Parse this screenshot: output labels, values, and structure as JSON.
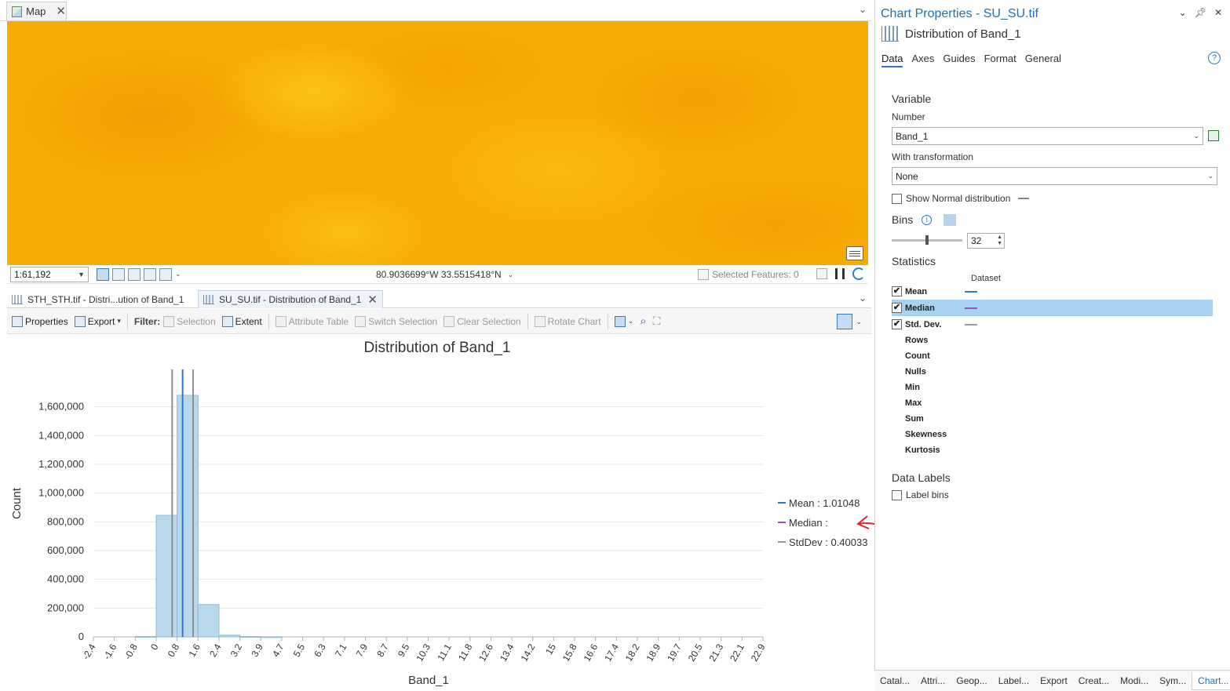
{
  "map": {
    "tab_label": "Map",
    "scale": "1:61,192",
    "coordinates": "80.9036699°W 33.5515418°N",
    "selected_features": "Selected Features: 0"
  },
  "chart_tabs": [
    {
      "label": "STH_STH.tif - Distri...ution of Band_1"
    },
    {
      "label": "SU_SU.tif - Distribution of Band_1"
    }
  ],
  "toolbar": {
    "properties": "Properties",
    "export": "Export",
    "filter": "Filter:",
    "selection": "Selection",
    "extent": "Extent",
    "attribute_table": "Attribute Table",
    "switch_selection": "Switch Selection",
    "clear_selection": "Clear Selection",
    "rotate_chart": "Rotate Chart"
  },
  "chart_data": {
    "type": "bar",
    "title": "Distribution of Band_1",
    "xlabel": "Band_1",
    "ylabel": "Count",
    "x_ticks": [
      "-2.4",
      "-1.6",
      "-0.8",
      "0",
      "0.8",
      "1.6",
      "2.4",
      "3.2",
      "3.9",
      "4.7",
      "5.5",
      "6.3",
      "7.1",
      "7.9",
      "8.7",
      "9.5",
      "10.3",
      "11.1",
      "11.8",
      "12.6",
      "13.4",
      "14.2",
      "15",
      "15.8",
      "16.6",
      "17.4",
      "18.2",
      "18.9",
      "19.7",
      "20.5",
      "21.3",
      "22.1",
      "22.9"
    ],
    "y_ticks": [
      "0",
      "200,000",
      "400,000",
      "600,000",
      "800,000",
      "1,000,000",
      "1,200,000",
      "1,400,000",
      "1,600,000"
    ],
    "ylim": [
      0,
      1800000
    ],
    "xlim": [
      -2.4,
      22.9
    ],
    "bins": [
      {
        "x0": -0.8,
        "x1": 0.0,
        "count": 3000
      },
      {
        "x0": 0.0,
        "x1": 0.8,
        "count": 845000
      },
      {
        "x0": 0.8,
        "x1": 1.6,
        "count": 1680000
      },
      {
        "x0": 1.6,
        "x1": 2.4,
        "count": 225000
      },
      {
        "x0": 2.4,
        "x1": 3.2,
        "count": 12000
      },
      {
        "x0": 3.2,
        "x1": 3.9,
        "count": 2500
      },
      {
        "x0": 3.9,
        "x1": 4.7,
        "count": 800
      }
    ],
    "mean": 1.01048,
    "stddev": 0.40033,
    "grid": true,
    "legend_placement": "right",
    "legend": [
      {
        "label": "Mean : 1.01048",
        "color": "#2a78d6"
      },
      {
        "label": "Median :",
        "color": "#9b4fc4"
      },
      {
        "label": "StdDev : 0.40033",
        "color": "#999999"
      }
    ],
    "colors": {
      "bar": "#b8d8eb",
      "bar_stroke": "#8fbcd8",
      "mean": "#2a78d6",
      "stddev": "#8f8f8f"
    }
  },
  "props": {
    "title": "Chart Properties - SU_SU.tif",
    "subtitle": "Distribution of Band_1",
    "tabs": [
      "Data",
      "Axes",
      "Guides",
      "Format",
      "General"
    ],
    "variable_title": "Variable",
    "number_label": "Number",
    "number_value": "Band_1",
    "transformation_label": "With transformation",
    "transformation_value": "None",
    "show_normal": "Show Normal distribution",
    "bins_label": "Bins",
    "bins_value": "32",
    "statistics_title": "Statistics",
    "dataset_header": "Dataset",
    "stats_checked": [
      {
        "name": "Mean",
        "color": "#2a78d6"
      },
      {
        "name": "Median",
        "color": "#9b4fc4"
      },
      {
        "name": "Std. Dev.",
        "color": "#999999"
      }
    ],
    "stats_plain": [
      "Rows",
      "Count",
      "Nulls",
      "Min",
      "Max",
      "Sum",
      "Skewness",
      "Kurtosis"
    ],
    "data_labels_title": "Data Labels",
    "label_bins": "Label bins"
  },
  "bottom_tabs": [
    "Catal...",
    "Attri...",
    "Geop...",
    "Label...",
    "Export",
    "Creat...",
    "Modi...",
    "Sym...",
    "Chart..."
  ],
  "annotation": {
    "text": "?",
    "color": "#d9262c"
  }
}
